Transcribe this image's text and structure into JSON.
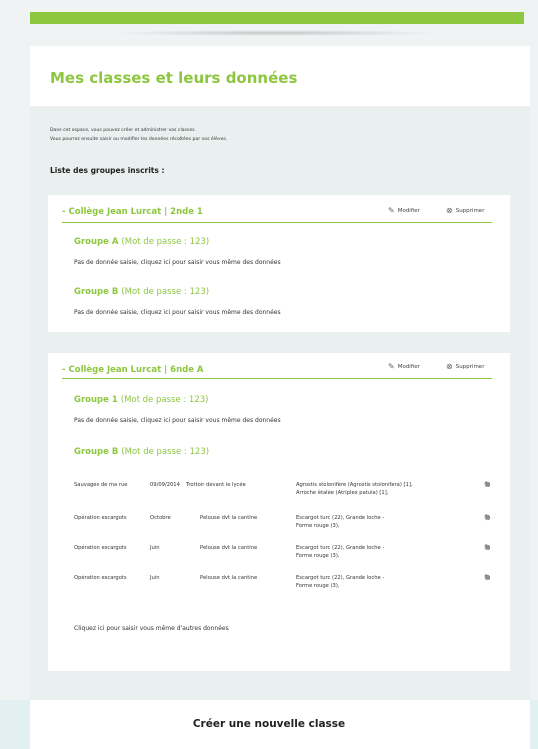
{
  "title": "Mes classes et leurs données",
  "intro": {
    "line1": "Dans cet espace, vous pouvez créer et administrer vos classes.",
    "line2": "Vous pourrez ensuite saisir ou modifier les données récoltées par vos élèves."
  },
  "list_title": "Liste des groupes inscrits :",
  "actions": {
    "edit": "Modifier",
    "delete": "Supprimer"
  },
  "cards": [
    {
      "heading": "- Collège  Jean Lurcat | 2nde 1",
      "groups": [
        {
          "name": "Groupe A",
          "password": "(Mot de passe : 123)",
          "message": "Pas de donnée saisie, cliquez ici pour saisir vous même des données"
        },
        {
          "name": "Groupe B",
          "password": "(Mot de passe : 123)",
          "message": "Pas de donnée saisie, cliquez ici pour saisir vous même des données"
        }
      ]
    },
    {
      "heading": "- Collège  Jean Lurcat | 6nde A",
      "groups": [
        {
          "name": "Groupe 1",
          "password": "(Mot de passe : 123)",
          "message": "Pas de donnée saisie, cliquez ici pour saisir vous même des données"
        },
        {
          "name": "Groupe B",
          "password": "(Mot de passe : 123)"
        }
      ],
      "rows": [
        {
          "protocol": "Sauvages de ma rue",
          "date": "09/09/2014",
          "place": "Trottoir devant le lycée",
          "data1": "Agrostis stolonifère (Agrostis stolonifera) [1],",
          "data2": "Arroche étalée (Atriplex patula) [1],"
        },
        {
          "protocol": "Opération escargots",
          "date": "Octobre",
          "place": "Pelouse dvt la cantine",
          "data1": "Escargot turc (22), Grande loche -",
          "data2": "Forme rouge (3),"
        },
        {
          "protocol": "Opération escargots",
          "date": "Juin",
          "place": "Pelouse dvt la cantine",
          "data1": "Escargot turc (22), Grande loche -",
          "data2": "Forme rouge (3),"
        },
        {
          "protocol": "Opération escargots",
          "date": "Juin",
          "place": "Pelouse dvt la cantine",
          "data1": "Escargot turc (22), Grande loche -",
          "data2": "Forme rouge (3),"
        }
      ],
      "footer_link": "Cliquez ici pour saisir vous même d'autres données"
    }
  ],
  "create_button": "Créer une nouvelle classe",
  "icons": {
    "edit": "pencil-icon",
    "delete": "circle-x-icon"
  },
  "colors": {
    "accent": "#8dc63f"
  }
}
